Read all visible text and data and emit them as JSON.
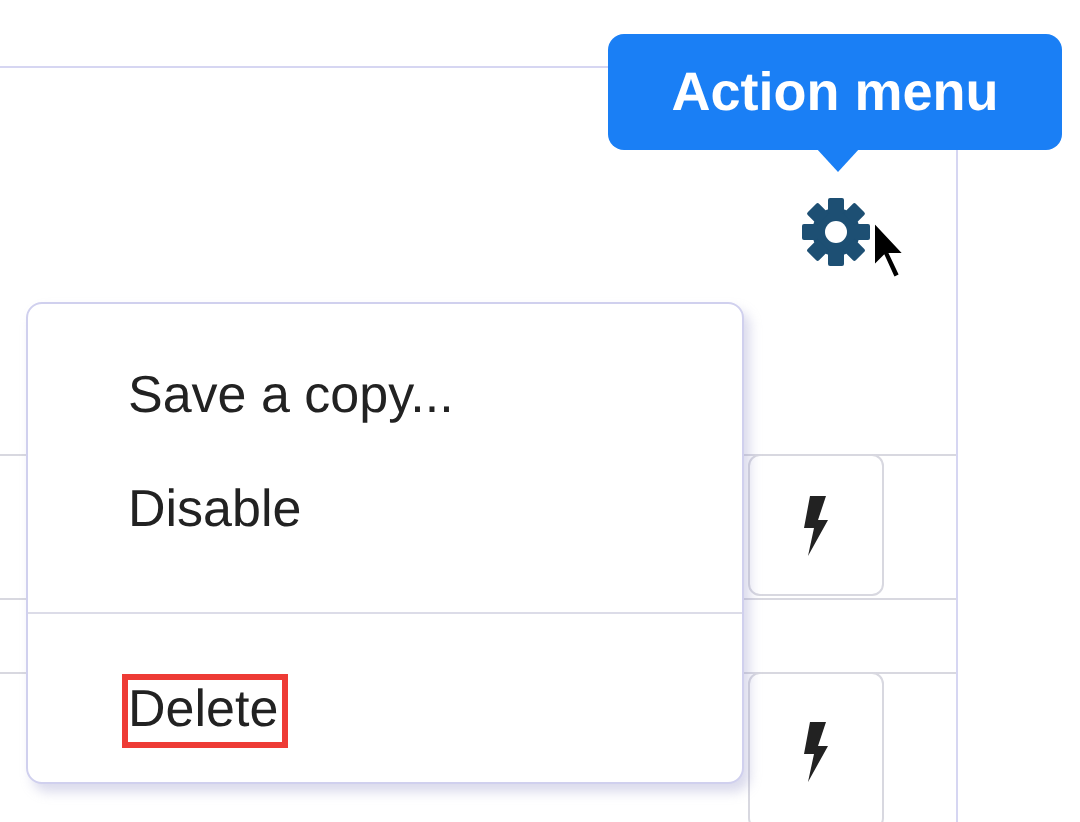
{
  "tooltip": {
    "text": "Action menu"
  },
  "menu": {
    "items": [
      {
        "label": "Save a copy...",
        "selected": false
      },
      {
        "label": "Disable",
        "selected": false
      },
      {
        "kind": "divider"
      },
      {
        "label": "Delete",
        "selected": true
      }
    ]
  }
}
